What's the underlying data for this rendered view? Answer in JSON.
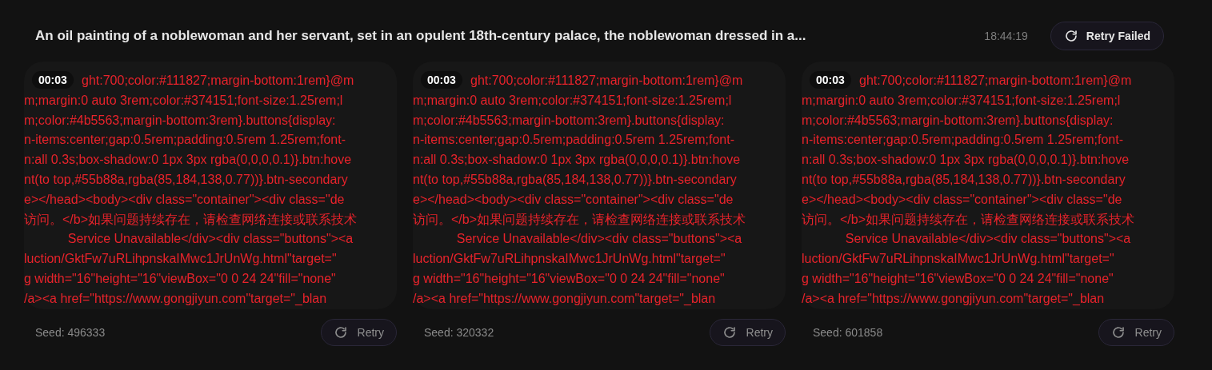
{
  "header": {
    "title": "An oil painting of a noblewoman and her servant, set in an opulent 18th-century palace, the noblewoman dressed in a...",
    "time": "18:44:19",
    "retry_failed": "Retry Failed"
  },
  "cards": [
    {
      "duration": "00:03",
      "lines": [
        "ght:700;color:#111827;margin-bottom:1rem}@m",
        "m;margin:0 auto 3rem;color:#374151;font-size:1.25rem;l",
        "m;color:#4b5563;margin-bottom:3rem}.buttons{display:",
        "n-items:center;gap:0.5rem;padding:0.5rem 1.25rem;font-",
        "n:all 0.3s;box-shadow:0 1px 3px rgba(0,0,0,0.1)}.btn:hove",
        "nt(to top,#55b88a,rgba(85,184,138,0.77))}.btn-secondary",
        "e></head><body><div class=\"container\"><div class=\"de",
        "访问。</b>如果问题持续存在，请检查网络连接或联系技术",
        "Service Unavailable</div><div class=\"buttons\"><a",
        "luction/GktFw7uRLihpnskaIMwc1JrUnWg.html\"target=\"",
        "g width=\"16\"height=\"16\"viewBox=\"0 0 24 24\"fill=\"none\"",
        "/a><a href=\"https://www.gongjiyun.com\"target=\"_blan"
      ],
      "seed": "Seed: 496333",
      "retry": "Retry"
    },
    {
      "duration": "00:03",
      "lines": [
        "ght:700;color:#111827;margin-bottom:1rem}@m",
        "m;margin:0 auto 3rem;color:#374151;font-size:1.25rem;l",
        "m;color:#4b5563;margin-bottom:3rem}.buttons{display:",
        "n-items:center;gap:0.5rem;padding:0.5rem 1.25rem;font-",
        "n:all 0.3s;box-shadow:0 1px 3px rgba(0,0,0,0.1)}.btn:hove",
        "nt(to top,#55b88a,rgba(85,184,138,0.77))}.btn-secondary",
        "e></head><body><div class=\"container\"><div class=\"de",
        "访问。</b>如果问题持续存在，请检查网络连接或联系技术",
        "Service Unavailable</div><div class=\"buttons\"><a",
        "luction/GktFw7uRLihpnskaIMwc1JrUnWg.html\"target=\"",
        "g width=\"16\"height=\"16\"viewBox=\"0 0 24 24\"fill=\"none\"",
        "/a><a href=\"https://www.gongjiyun.com\"target=\"_blan"
      ],
      "seed": "Seed: 320332",
      "retry": "Retry"
    },
    {
      "duration": "00:03",
      "lines": [
        "ght:700;color:#111827;margin-bottom:1rem}@m",
        "m;margin:0 auto 3rem;color:#374151;font-size:1.25rem;l",
        "m;color:#4b5563;margin-bottom:3rem}.buttons{display:",
        "n-items:center;gap:0.5rem;padding:0.5rem 1.25rem;font-",
        "n:all 0.3s;box-shadow:0 1px 3px rgba(0,0,0,0.1)}.btn:hove",
        "nt(to top,#55b88a,rgba(85,184,138,0.77))}.btn-secondary",
        "e></head><body><div class=\"container\"><div class=\"de",
        "访问。</b>如果问题持续存在，请检查网络连接或联系技术",
        "Service Unavailable</div><div class=\"buttons\"><a",
        "luction/GktFw7uRLihpnskaIMwc1JrUnWg.html\"target=\"",
        "g width=\"16\"height=\"16\"viewBox=\"0 0 24 24\"fill=\"none\"",
        "/a><a href=\"https://www.gongjiyun.com\"target=\"_blan"
      ],
      "seed": "Seed: 601858",
      "retry": "Retry"
    }
  ]
}
